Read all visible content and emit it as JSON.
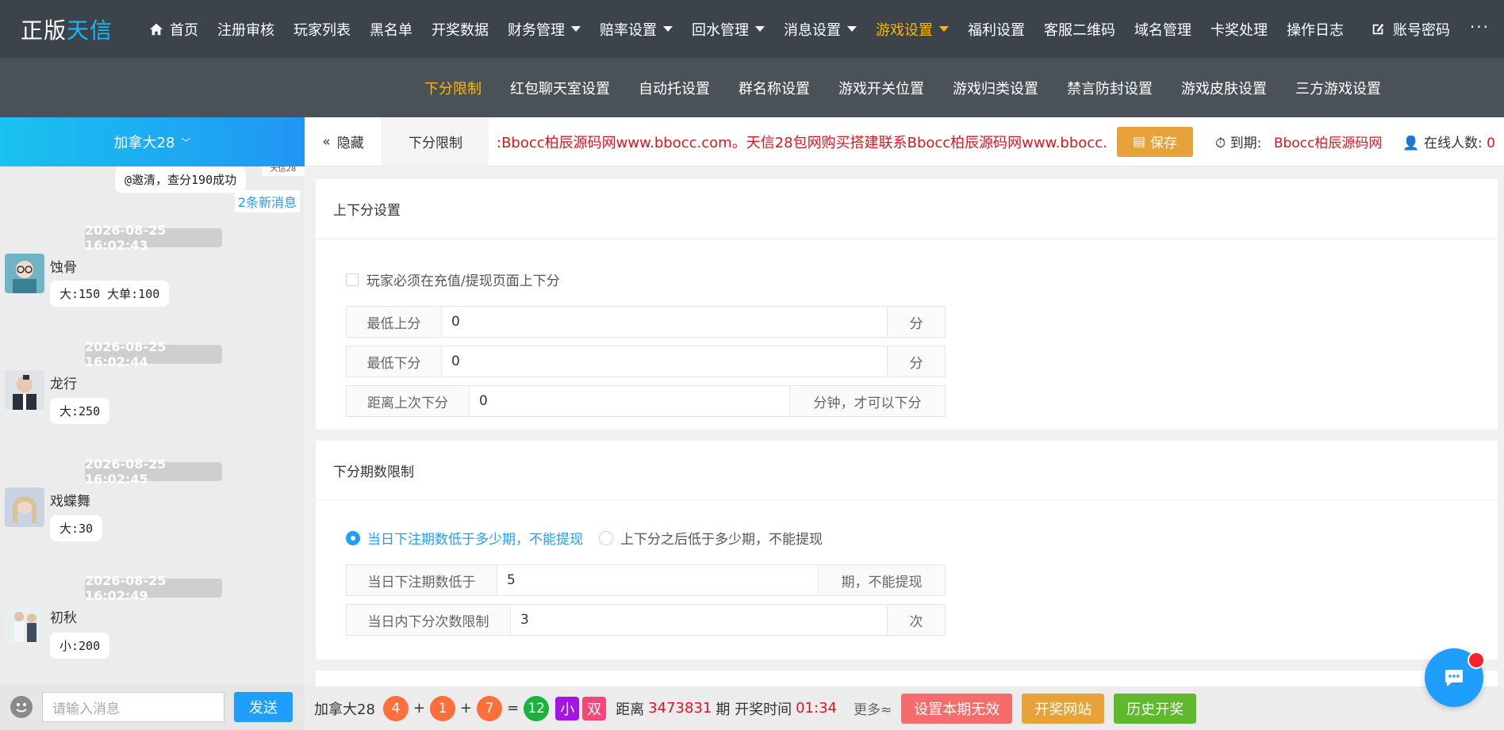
{
  "app": {
    "logo": "正版天信",
    "logo_prefix": "正版",
    "logo_suffix": "天信"
  },
  "topnav": [
    {
      "label": "首页",
      "icon": "home-icon"
    },
    {
      "label": "注册审核"
    },
    {
      "label": "玩家列表"
    },
    {
      "label": "黑名单"
    },
    {
      "label": "开奖数据"
    },
    {
      "label": "财务管理",
      "dropdown": true
    },
    {
      "label": "赔率设置",
      "dropdown": true
    },
    {
      "label": "回水管理",
      "dropdown": true
    },
    {
      "label": "消息设置",
      "dropdown": true
    },
    {
      "label": "游戏设置",
      "dropdown": true,
      "active": true
    },
    {
      "label": "福利设置"
    },
    {
      "label": "客服二维码"
    },
    {
      "label": "域名管理"
    },
    {
      "label": "卡奖处理"
    },
    {
      "label": "操作日志"
    },
    {
      "label": "账号密码",
      "icon": "edit-icon"
    }
  ],
  "topnav_more": "···",
  "subnav": [
    "下分限制",
    "红包聊天室设置",
    "自动托设置",
    "群名称设置",
    "游戏开关位置",
    "游戏归类设置",
    "禁言防封设置",
    "游戏皮肤设置",
    "三方游戏设置"
  ],
  "subnav_active": "下分限制",
  "chat": {
    "room": "加拿大28",
    "logo_peek": "天信28",
    "top_bubble": "@邀清，查分190成功",
    "new_messages": "2条新消息",
    "messages": [
      {
        "time": "2026-08-25 16:02:43",
        "user": "蚀骨",
        "text": "大:150 大单:100"
      },
      {
        "time": "2026-08-25 16:02:44",
        "user": "龙行",
        "text": "大:250"
      },
      {
        "time": "2026-08-25 16:02:45",
        "user": "戏蝶舞",
        "text": "大:30"
      },
      {
        "time": "2026-08-25 16:02:49",
        "user": "初秋",
        "text": "小:200"
      }
    ],
    "input_placeholder": "请输入消息",
    "send": "发送"
  },
  "tabstrip": {
    "hide": "隐藏",
    "active_tab": "下分限制",
    "marquee": ":Bbocc柏辰源码网www.bbocc.com。天信28包网购买搭建联系Bbocc柏辰源码网www.bbocc.com。",
    "save": "保存",
    "expire_label": "到期:",
    "expire_value": "Bbocc柏辰源码网",
    "online_label": "在线人数:",
    "online_value": "0"
  },
  "card1": {
    "title": "上下分设置",
    "checkbox_label": "玩家必须在充值/提现页面上下分",
    "checkbox_checked": false,
    "fields": [
      {
        "label": "最低上分",
        "value": "0",
        "suffix": "分"
      },
      {
        "label": "最低下分",
        "value": "0",
        "suffix": "分"
      },
      {
        "label": "距离上次下分",
        "value": "0",
        "suffix": "分钟，才可以下分"
      }
    ]
  },
  "card2": {
    "title": "下分期数限制",
    "radio1": "当日下注期数低于多少期，不能提现",
    "radio2": "上下分之后低于多少期，不能提现",
    "selected": "radio1",
    "fields": [
      {
        "label": "当日下注期数低于",
        "value": "5",
        "suffix": "期，不能提现"
      },
      {
        "label": "当日内下分次数限制",
        "value": "3",
        "suffix": "次"
      }
    ]
  },
  "bottombar": {
    "game": "加拿大28",
    "balls": [
      "4",
      "1",
      "7"
    ],
    "plus": "+",
    "equals": "=",
    "sum": "12",
    "tag_size": "小",
    "tag_parity": "双",
    "period_prefix": "距离",
    "period": "3473831",
    "period_suffix": "期 开奖时间",
    "countdown": "01:34",
    "more": "更多≈",
    "btn_invalidate": "设置本期无效",
    "btn_site": "开奖网站",
    "btn_history": "历史开奖"
  },
  "colors": {
    "accent": "#1e9fff",
    "active_nav": "#ffb800",
    "topbar": "#3d434b",
    "subbar": "#4a5159",
    "danger": "#e0141e"
  }
}
